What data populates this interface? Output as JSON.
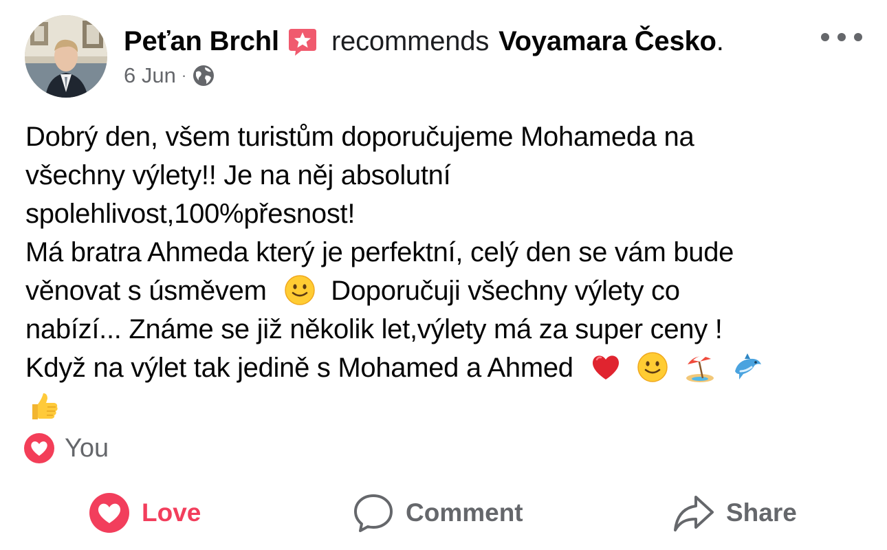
{
  "post": {
    "author": "Peťan Brchl",
    "recommends_text": "recommends",
    "page_name": "Voyamara Česko",
    "period": ".",
    "date": "6 Jun",
    "separator": "·",
    "privacy_icon": "globe-icon",
    "body_lines": [
      "Dobrý den, všem turistům doporučujeme Mohameda na",
      "všechny výlety!! Je na něj absolutní",
      "spolehlivost,100%přesnost!",
      "Má bratra Ahmeda který je perfektní, celý den se vám bude",
      "věnovat s úsměvem",
      "Doporučuji všechny výlety co",
      "nabízí... Známe se již několik let,výlety má za super ceny !",
      "Když na výlet tak jedině s Mohamed a Ahmed"
    ],
    "emojis": [
      "slightly-smiling-face",
      "red-heart",
      "slightly-smiling-face",
      "beach-umbrella",
      "dolphin",
      "thumbs-up"
    ]
  },
  "reactions": {
    "icon": "love-reaction-icon",
    "summary": "You"
  },
  "actions": {
    "love_label": "Love",
    "comment_label": "Comment",
    "share_label": "Share"
  },
  "colors": {
    "love": "#f23e5c",
    "secondary_text": "#65676b",
    "primary_text": "#050505"
  }
}
